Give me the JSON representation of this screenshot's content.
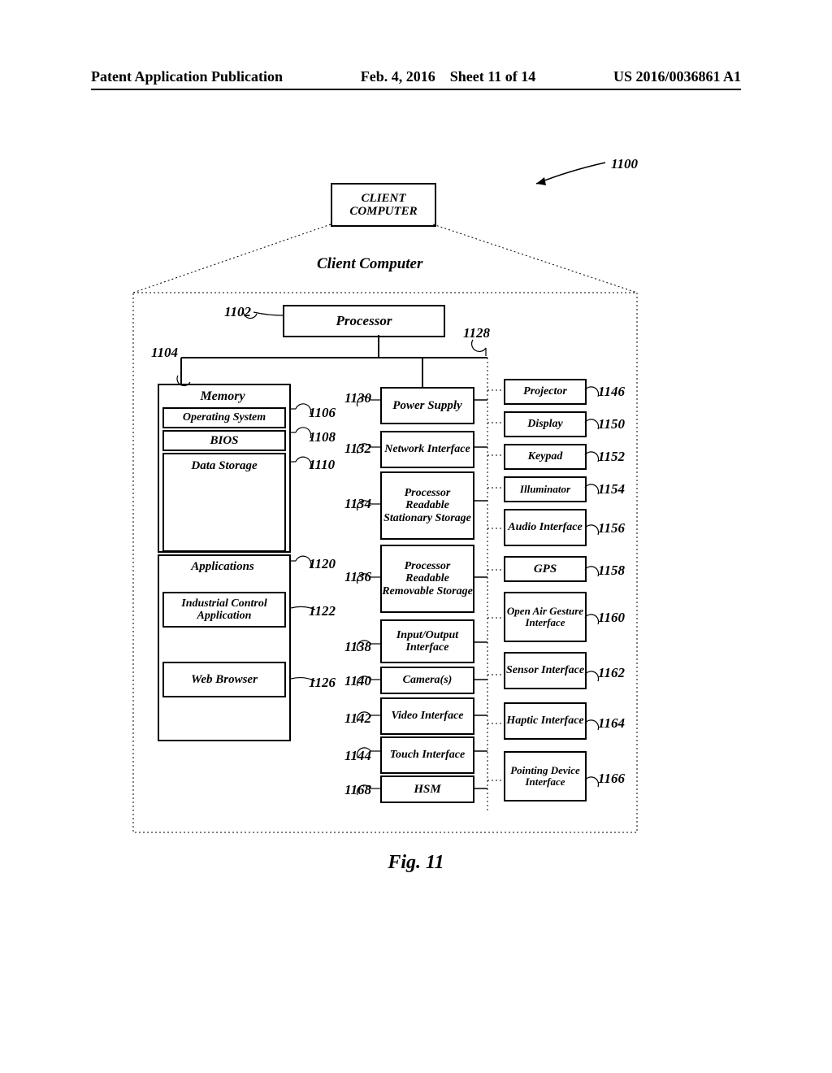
{
  "header": {
    "pub_type": "Patent Application Publication",
    "date": "Feb. 4, 2016",
    "sheet": "Sheet 11 of 14",
    "pub_no": "US 2016/0036861 A1"
  },
  "title_box": "CLIENT COMPUTER",
  "system_ref": "1100",
  "subtitle": "Client Computer",
  "figure_caption": "Fig. 11",
  "blocks": {
    "processor": "Processor",
    "memory": "Memory",
    "os": "Operating System",
    "bios": "BIOS",
    "data_storage": "Data Storage",
    "applications": "Applications",
    "ic_app": "Industrial Control Application",
    "web_browser": "Web Browser",
    "power_supply": "Power Supply",
    "net_if": "Network Interface",
    "pr_stationary": "Processor Readable Stationary Storage",
    "pr_removable": "Processor Readable Removable Storage",
    "io_if": "Input/Output Interface",
    "cameras": "Camera(s)",
    "video_if": "Video Interface",
    "touch_if": "Touch Interface",
    "hsm": "HSM",
    "projector": "Projector",
    "display": "Display",
    "keypad": "Keypad",
    "illuminator": "Illuminator",
    "audio_if": "Audio Interface",
    "gps": "GPS",
    "open_air": "Open Air Gesture Interface",
    "sensor_if": "Sensor Interface",
    "haptic_if": "Haptic Interface",
    "pointing_if": "Pointing Device Interface"
  },
  "refs": {
    "r1102": "1102",
    "r1104": "1104",
    "r1106": "1106",
    "r1108": "1108",
    "r1110": "1110",
    "r1120": "1120",
    "r1122": "1122",
    "r1126": "1126",
    "r1128": "1128",
    "r1130": "1130",
    "r1132": "1132",
    "r1134": "1134",
    "r1136": "1136",
    "r1138": "1138",
    "r1140": "1140",
    "r1142": "1142",
    "r1144": "1144",
    "r1146": "1146",
    "r1150": "1150",
    "r1152": "1152",
    "r1154": "1154",
    "r1156": "1156",
    "r1158": "1158",
    "r1160": "1160",
    "r1162": "1162",
    "r1164": "1164",
    "r1166": "1166",
    "r1168": "1168"
  }
}
